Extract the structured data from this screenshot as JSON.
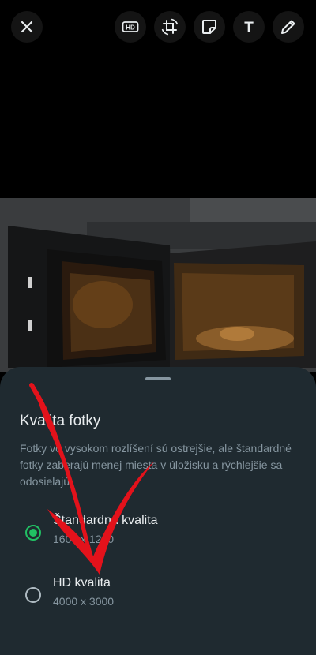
{
  "toolbar": {
    "close_icon": "close-icon",
    "hd_icon": "hd-icon",
    "crop_icon": "crop-rotate-icon",
    "sticker_icon": "sticker-icon",
    "text_icon": "text-icon",
    "pencil_icon": "pencil-icon",
    "hd_text": "HD",
    "text_tool_glyph": "T"
  },
  "sheet": {
    "title": "Kvalita fotky",
    "description": "Fotky vo vysokom rozlíšení sú ostrejšie, ale štandardné fotky zaberajú menej miesta v úložisku a rýchlejšie sa odosielajú.",
    "options": [
      {
        "label": "Štandardná kvalita",
        "resolution": "1600 x 1200",
        "selected": true
      },
      {
        "label": "HD kvalita",
        "resolution": "4000 x 3000",
        "selected": false
      }
    ]
  },
  "colors": {
    "sheet_bg": "#1f2a30",
    "accent": "#21c063",
    "secondary_text": "#8696a0",
    "annotation_arrow": "#e3121b"
  }
}
